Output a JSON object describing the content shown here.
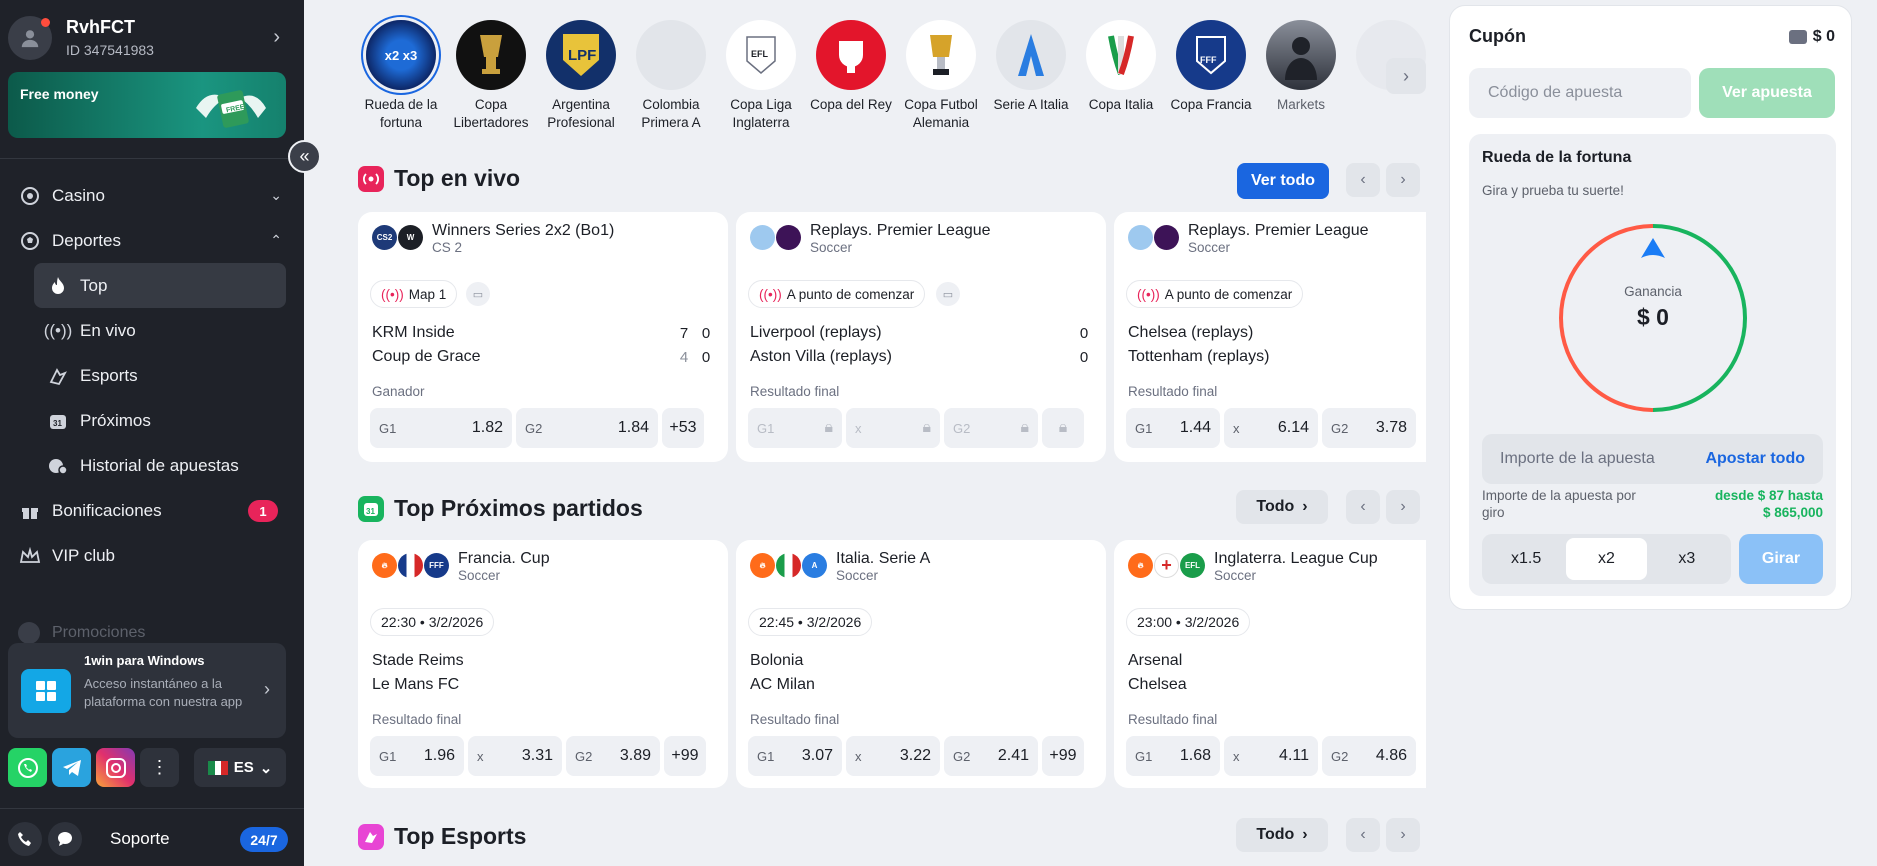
{
  "user": {
    "name": "RvhFCT",
    "id": "ID 347541983"
  },
  "banner": {
    "text": "Free money"
  },
  "nav": {
    "casino": "Casino",
    "deportes": "Deportes",
    "sub": [
      "Top",
      "En vivo",
      "Esports",
      "Próximos",
      "Historial de apuestas"
    ],
    "bonificaciones": "Bonificaciones",
    "bonus_count": "1",
    "vip": "VIP club",
    "promociones": "Promociones"
  },
  "winapp": {
    "title": "1win para Windows",
    "desc": "Acceso instantáneo a la plataforma con nuestra app"
  },
  "lang": "ES",
  "support": {
    "label": "Soporte",
    "badge": "24/7"
  },
  "categories": [
    "Rueda de la fortuna",
    "Copa Libertadores",
    "Argentina Profesional",
    "Colombia Primera A",
    "Copa Liga Inglaterra",
    "Copa del Rey",
    "Copa Futbol Alemania",
    "Serie A Italia",
    "Copa Italia",
    "Copa Francia",
    "Markets"
  ],
  "live": {
    "title": "Top en vivo",
    "ver_todo": "Ver todo",
    "cards": [
      {
        "title": "Winners Series 2x2 (Bo1)",
        "sport": "CS 2",
        "status": "Map 1",
        "team1": "KRM Inside",
        "team2": "Coup de Grace",
        "s1a": "7",
        "s1b": "0",
        "s2a": "4",
        "s2b": "0",
        "market": "Ganador",
        "o1k": "G1",
        "o1": "1.82",
        "o2k": "G2",
        "o2": "1.84",
        "more": "+53"
      },
      {
        "title": "Replays. Premier League",
        "sport": "Soccer",
        "status": "A punto de comenzar",
        "team1": "Liverpool (replays)",
        "team2": "Aston Villa (replays)",
        "s1": "0",
        "s2": "0",
        "market": "Resultado final",
        "o1k": "G1",
        "oxk": "x",
        "o2k": "G2"
      },
      {
        "title": "Replays. Premier League",
        "sport": "Soccer",
        "status": "A punto de comenzar",
        "team1": "Chelsea (replays)",
        "team2": "Tottenham (replays)",
        "market": "Resultado final",
        "o1k": "G1",
        "o1": "1.44",
        "oxk": "x",
        "ox": "6.14",
        "o2k": "G2",
        "o2": "3.78"
      }
    ]
  },
  "upcoming": {
    "title": "Top Próximos partidos",
    "todo": "Todo",
    "cards": [
      {
        "title": "Francia. Cup",
        "sport": "Soccer",
        "time": "22:30",
        "date": "3/2/2026",
        "team1": "Stade Reims",
        "team2": "Le Mans FC",
        "market": "Resultado final",
        "o1k": "G1",
        "o1": "1.96",
        "oxk": "x",
        "ox": "3.31",
        "o2k": "G2",
        "o2": "3.89",
        "more": "+99"
      },
      {
        "title": "Italia. Serie A",
        "sport": "Soccer",
        "time": "22:45",
        "date": "3/2/2026",
        "team1": "Bolonia",
        "team2": "AC Milan",
        "market": "Resultado final",
        "o1k": "G1",
        "o1": "3.07",
        "oxk": "x",
        "ox": "3.22",
        "o2k": "G2",
        "o2": "2.41",
        "more": "+99"
      },
      {
        "title": "Inglaterra. League Cup",
        "sport": "Soccer",
        "time": "23:00",
        "date": "3/2/2026",
        "team1": "Arsenal",
        "team2": "Chelsea",
        "market": "Resultado final",
        "o1k": "G1",
        "o1": "1.68",
        "oxk": "x",
        "ox": "4.11",
        "o2k": "G2",
        "o2": "4.86"
      }
    ]
  },
  "esports": {
    "title": "Top Esports",
    "todo": "Todo"
  },
  "coupon": {
    "title": "Cupón",
    "balance": "$ 0",
    "code_placeholder": "Código de apuesta",
    "ver_apuesta": "Ver apuesta",
    "wheel_title": "Rueda de la fortuna",
    "wheel_sub": "Gira y prueba tu suerte!",
    "gain_label": "Ganancia",
    "gain_value": "$ 0",
    "amount_placeholder": "Importe de la apuesta",
    "apostar_todo": "Apostar todo",
    "per_spin": "Importe de la apuesta por giro",
    "range_from": "desde $ 87 hasta",
    "range_to": "$ 865,000",
    "multipliers": [
      "x1.5",
      "x2",
      "x3"
    ],
    "girar": "Girar"
  }
}
